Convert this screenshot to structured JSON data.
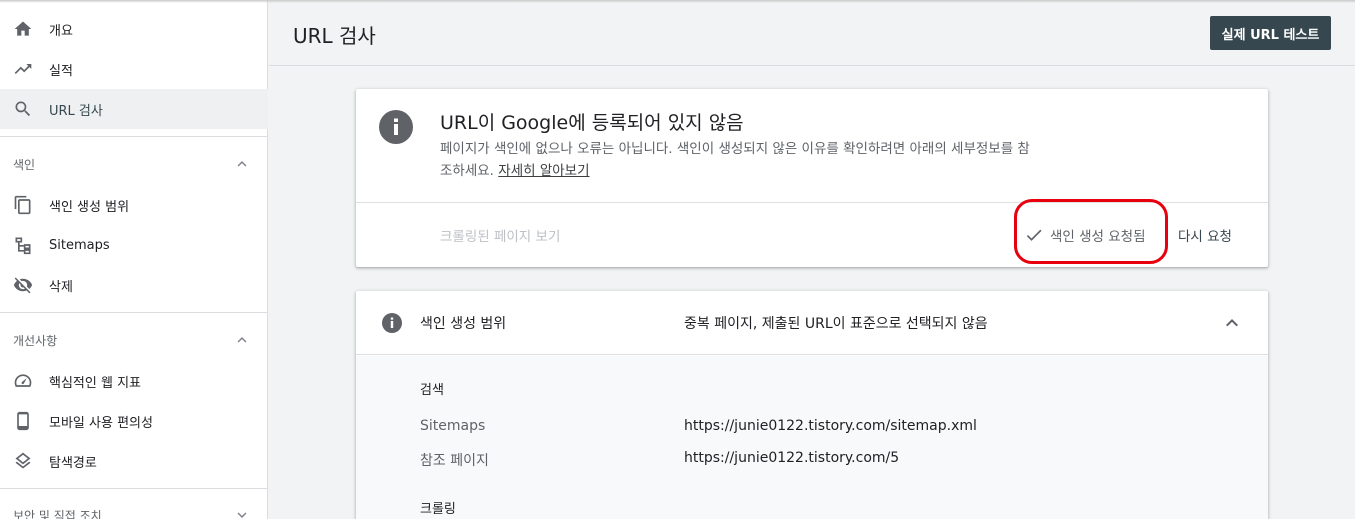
{
  "sidebar": {
    "items": [
      {
        "label": "개요",
        "icon": "home-icon"
      },
      {
        "label": "실적",
        "icon": "trending-up-icon"
      },
      {
        "label": "URL 검사",
        "icon": "search-icon"
      }
    ],
    "sections": [
      {
        "label": "색인",
        "items": [
          {
            "label": "색인 생성 범위",
            "icon": "copy-icon"
          },
          {
            "label": "Sitemaps",
            "icon": "sitemap-icon"
          },
          {
            "label": "삭제",
            "icon": "eye-off-icon"
          }
        ]
      },
      {
        "label": "개선사항",
        "items": [
          {
            "label": "핵심적인 웹 지표",
            "icon": "gauge-icon"
          },
          {
            "label": "모바일 사용 편의성",
            "icon": "smartphone-icon"
          },
          {
            "label": "탐색경로",
            "icon": "layers-icon"
          }
        ]
      },
      {
        "label": "보안 및 직접 조치",
        "items": []
      }
    ]
  },
  "header": {
    "title": "URL 검사",
    "live_test_label": "실제 URL 테스트"
  },
  "status_card": {
    "title": "URL이 Google에 등록되어 있지 않음",
    "description": "페이지가 색인에 없으나 오류는 아닙니다. 색인이 생성되지 않은 이유를 확인하려면 아래의 세부정보를 참조하세요.",
    "learn_more": "자세히 알아보기",
    "crawled_page_label": "크롤링된 페이지 보기",
    "indexing_requested_label": "색인 생성 요청됨",
    "request_again_label": "다시 요청"
  },
  "coverage": {
    "label": "색인 생성 범위",
    "value": "중복 페이지, 제출된 URL이 표준으로 선택되지 않음",
    "discovery_heading": "검색",
    "sitemaps_label": "Sitemaps",
    "sitemaps_value": "https://junie0122.tistory.com/sitemap.xml",
    "referring_label": "참조 페이지",
    "referring_value": "https://junie0122.tistory.com/5",
    "crawl_heading": "크롤링"
  },
  "colors": {
    "accent": "#37474f",
    "highlight_oval": "#e8000f"
  }
}
